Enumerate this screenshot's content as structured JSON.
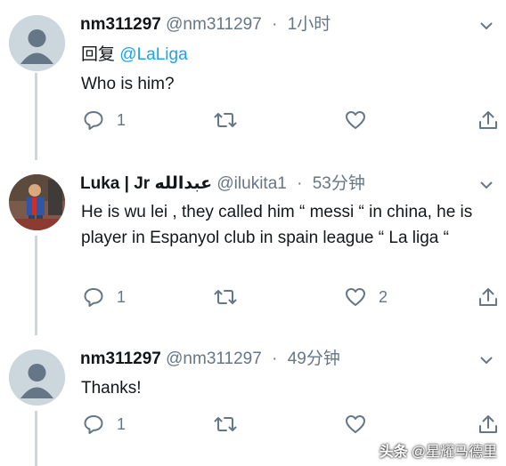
{
  "tweets": [
    {
      "name": "nm311297",
      "handle": "@nm311297",
      "dot": "·",
      "time": "1小时",
      "reply_label": "回复",
      "mention": "@LaLiga",
      "text": "Who is him?",
      "reply_count": "1",
      "retweet_count": "",
      "like_count": ""
    },
    {
      "name": "Luka | Jr عبدالله",
      "handle": "@ilukita1",
      "dot": "·",
      "time": "53分钟",
      "text": "He is wu lei , they called him “ messi “ in china, he is player in Espanyol club in spain league “ La liga “",
      "reply_count": "1",
      "retweet_count": "",
      "like_count": "2"
    },
    {
      "name": "nm311297",
      "handle": "@nm311297",
      "dot": "·",
      "time": "49分钟",
      "text": "Thanks!",
      "reply_count": "1",
      "retweet_count": "",
      "like_count": ""
    }
  ],
  "watermark": {
    "prefix": "头条",
    "author": "@星耀马德里"
  },
  "colors": {
    "accent": "#1da1f2",
    "secondary_text": "#657786",
    "thread_line": "#ccd6dd"
  }
}
